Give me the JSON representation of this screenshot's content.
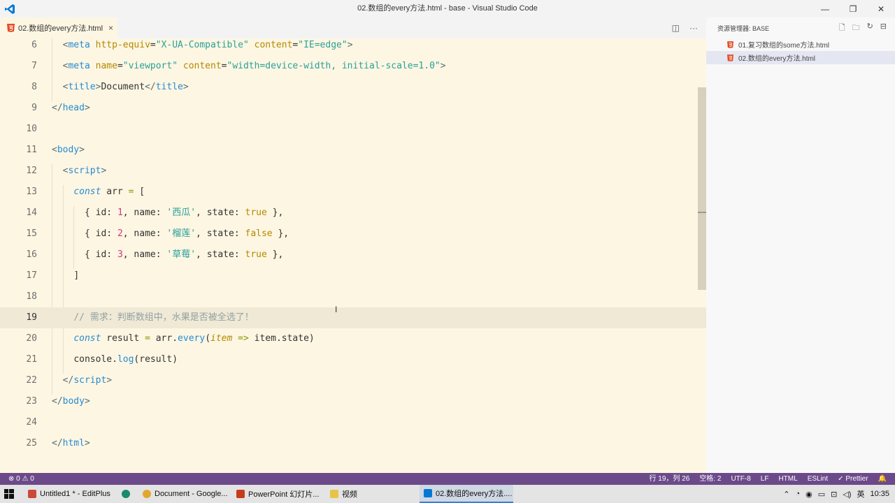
{
  "window": {
    "title": "02.数组的every方法.html - base - Visual Studio Code",
    "controls": [
      "—",
      "❐",
      "✕"
    ]
  },
  "tab": {
    "label": "02.数组的every方法.html",
    "close": "×"
  },
  "explorer": {
    "header": "资源管理器: BASE",
    "files": [
      {
        "label": "01.复习数组的some方法.html"
      },
      {
        "label": "02.数组的every方法.html"
      }
    ]
  },
  "editor": {
    "line_numbers": [
      "6",
      "7",
      "8",
      "9",
      "10",
      "11",
      "12",
      "13",
      "14",
      "15",
      "16",
      "17",
      "18",
      "19",
      "20",
      "21",
      "22",
      "23",
      "24",
      "25"
    ],
    "current_line": "19"
  },
  "status": {
    "problems": "⊗ 0 ⚠ 0",
    "position": "行 19，列 26",
    "spaces": "空格: 2",
    "encoding": "UTF-8",
    "eol": "LF",
    "language": "HTML",
    "eslint": "ESLint",
    "prettier": "✓ Prettier",
    "bell": "🔔"
  },
  "taskbar": {
    "items": [
      {
        "label": "Untitled1 * - EditPlus"
      },
      {
        "label": ""
      },
      {
        "label": "Document - Google..."
      },
      {
        "label": "PowerPoint 幻灯片..."
      },
      {
        "label": "视频"
      },
      {
        "label": "02.数组的every方法...."
      }
    ],
    "ime": "英",
    "time": "10:35"
  },
  "colors": {
    "editor_bg": "#fdf6e3",
    "statusbar": "#6c4a8a",
    "keyword": "#268bd2",
    "string": "#2aa198",
    "attr": "#b58900"
  }
}
